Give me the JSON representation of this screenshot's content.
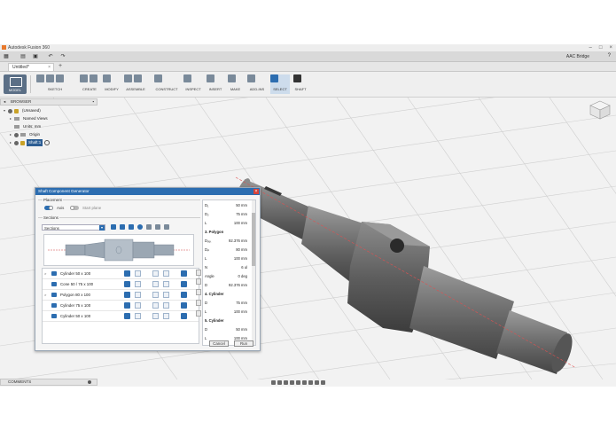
{
  "window": {
    "title": "Autodesk Fusion 360"
  },
  "qat": {
    "user": "AAC Bridge"
  },
  "tab": {
    "name": "Untitled*",
    "close": "×",
    "plus": "+"
  },
  "toolbar": {
    "mode": "MODEL",
    "groups": [
      "SKETCH",
      "CREATE",
      "MODIFY",
      "ASSEMBLE",
      "CONSTRUCT",
      "INSPECT",
      "INSERT",
      "MAKE",
      "ADD-INS",
      "SELECT",
      "SHAFT"
    ]
  },
  "browser": {
    "title": "BROWSER",
    "items": [
      "(Unsaved)",
      "Named Views",
      "Units: mm",
      "Origin",
      "Shaft:1"
    ]
  },
  "comments": {
    "label": "COMMENTS"
  },
  "dialog": {
    "title": "Shaft Component Generator",
    "close": "×",
    "placement_label": "Placement",
    "axis_label": "Axis",
    "start_plane_label": "Start plane",
    "sections_label": "Sections",
    "sections_select": "Sections",
    "rows": [
      {
        "name": "Cylinder 50 x 100",
        "expand": ">"
      },
      {
        "name": "Cone 50 / 75 x 100",
        "expand": ""
      },
      {
        "name": "Polygon 80 x 100",
        "expand": ">"
      },
      {
        "name": "Cylinder 75 x 100",
        "expand": ""
      },
      {
        "name": "Cylinder 50 x 100",
        "expand": ""
      }
    ],
    "params": [
      {
        "label": "D₁",
        "value": "50 mm"
      },
      {
        "label": "D₂",
        "value": "75 mm"
      },
      {
        "label": "L",
        "value": "100 mm"
      },
      {
        "label": "3. Polygon",
        "value": "",
        "header": true
      },
      {
        "label": "Dₒᵤₜ",
        "value": "92.376 mm"
      },
      {
        "label": "Dᵢₙ",
        "value": "80 mm"
      },
      {
        "label": "L",
        "value": "100 mm"
      },
      {
        "label": "N",
        "value": "6 ul"
      },
      {
        "label": "Angle",
        "value": "0 deg"
      },
      {
        "label": "D",
        "value": "92.376 mm"
      },
      {
        "label": "4. Cylinder",
        "value": "",
        "header": true
      },
      {
        "label": "D",
        "value": "75 mm"
      },
      {
        "label": "L",
        "value": "100 mm"
      },
      {
        "label": "5. Cylinder",
        "value": "",
        "header": true
      },
      {
        "label": "D",
        "value": "50 mm"
      },
      {
        "label": "L",
        "value": "100 mm"
      }
    ],
    "cancel": "Cancel",
    "run": "Run"
  },
  "colors": {
    "accent": "#2c6db0",
    "title_bar": "#2c6db0",
    "shaft": "#6f6f6f",
    "grid": "#c9c9c9"
  }
}
